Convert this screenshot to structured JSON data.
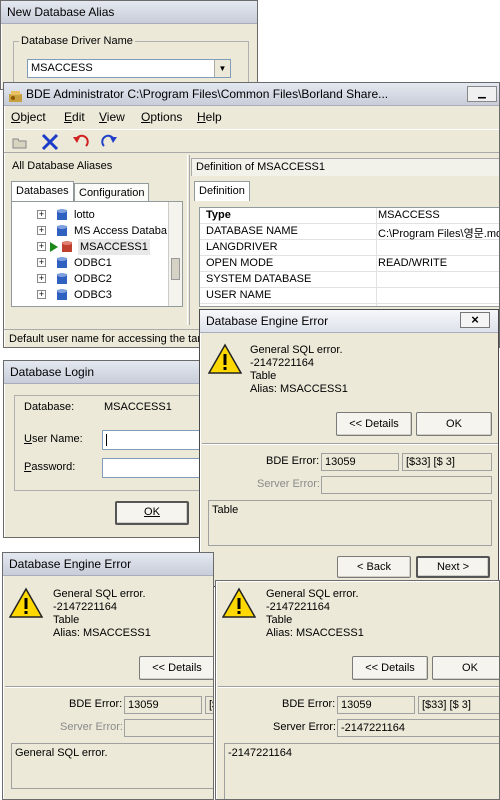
{
  "alias_dialog": {
    "title": "New Database Alias",
    "group_label": "Database Driver Name",
    "driver_value": "MSACCESS"
  },
  "bde_admin": {
    "title": "BDE Administrator  C:\\Program Files\\Common Files\\Borland Share...",
    "menu": [
      "Object",
      "Edit",
      "View",
      "Options",
      "Help"
    ],
    "left_header": "All Database Aliases",
    "right_header": "Definition of MSACCESS1",
    "tabs": [
      "Databases",
      "Configuration"
    ],
    "right_tab": "Definition",
    "tree": [
      "lotto",
      "MS Access Databa",
      "MSACCESS1",
      "ODBC1",
      "ODBC2",
      "ODBC3"
    ],
    "props": [
      {
        "name": "Type",
        "value": "MSACCESS"
      },
      {
        "name": "DATABASE NAME",
        "value": "C:\\Program Files\\영문.md"
      },
      {
        "name": "LANGDRIVER",
        "value": ""
      },
      {
        "name": "OPEN MODE",
        "value": "READ/WRITE"
      },
      {
        "name": "SYSTEM DATABASE",
        "value": ""
      },
      {
        "name": "USER NAME",
        "value": ""
      }
    ],
    "status": "Default user name for accessing the targ"
  },
  "login": {
    "title": "Database Login",
    "database_label": "Database:",
    "database_value": "MSACCESS1",
    "user_label": "User Name:",
    "password_label": "Password:",
    "ok": "OK"
  },
  "error_top": {
    "title": "Database Engine Error",
    "message": [
      "General SQL error.",
      "-2147221164",
      "Table",
      "Alias: MSACCESS1"
    ],
    "details": "<< Details",
    "ok": "OK",
    "bde_error_label": "BDE Error:",
    "bde_error": "13059",
    "bde_code": "[$33] [$ 3]",
    "server_error_label": "Server Error:",
    "server_error": "",
    "text": "Table",
    "back": "< Back",
    "next": "Next >"
  },
  "error_left": {
    "title": "Database Engine Error",
    "message": [
      "General SQL error.",
      "-2147221164",
      "Table",
      "Alias: MSACCESS1"
    ],
    "details": "<< Details",
    "bde_error_label": "BDE Error:",
    "bde_error": "13059",
    "bde_code": "[$",
    "server_error_label": "Server Error:",
    "text": "General SQL error."
  },
  "error_right": {
    "message": [
      "General SQL error.",
      "-2147221164",
      "Table",
      "Alias: MSACCESS1"
    ],
    "details": "<< Details",
    "ok": "OK",
    "bde_error_label": "BDE Error:",
    "bde_error": "13059",
    "bde_code": "[$33] [$ 3]",
    "server_error_label": "Server Error:",
    "server_error": "-2147221164",
    "text": "-2147221164"
  }
}
